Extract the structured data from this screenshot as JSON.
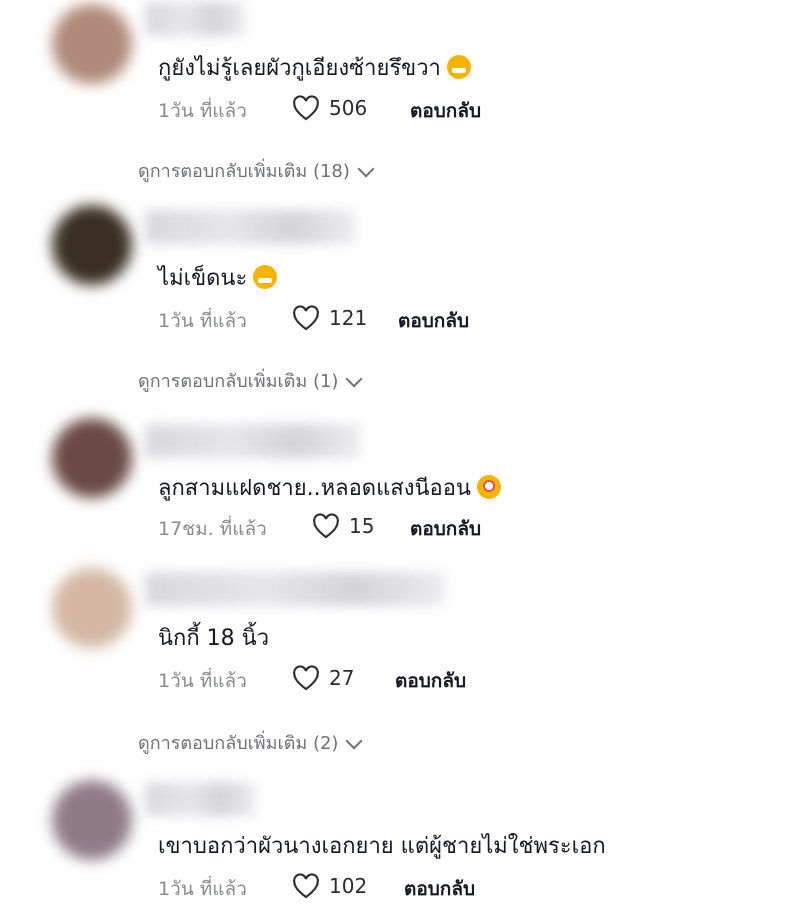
{
  "comments": [
    {
      "text": "กูยังไม่รู้เลยผัวกูเอียงซ้ายรึขวา",
      "emoji": "grinning-emoji",
      "time": "1วัน ที่แล้ว",
      "likes": "506",
      "reply": "ตอบกลับ",
      "more": "ดูการตอบกลับเพิ่มเติม (18)",
      "avatar_color": "#b08a7a"
    },
    {
      "text": "ไม่เข็ดนะ",
      "emoji": "smiling-emoji",
      "time": "1วัน ที่แล้ว",
      "likes": "121",
      "reply": "ตอบกลับ",
      "more": "ดูการตอบกลับเพิ่มเติม (1)",
      "avatar_color": "#3a2f22"
    },
    {
      "text": "ลูกสามแฝดชาย..หลอดแสงนีออน",
      "emoji": "flushed-emoji",
      "time": "17ชม. ที่แล้ว",
      "likes": "15",
      "reply": "ตอบกลับ",
      "more": "",
      "avatar_color": "#6a4a45"
    },
    {
      "text": "นิกกี้ 18 นิ้ว",
      "emoji": "",
      "time": "1วัน ที่แล้ว",
      "likes": "27",
      "reply": "ตอบกลับ",
      "more": "ดูการตอบกลับเพิ่มเติม (2)",
      "avatar_color": "#d4b8a4"
    },
    {
      "text": "เขาบอกว่าผัวนางเอกยาย แต่ผู้ชายไม่ใช่พระเอก",
      "emoji": "",
      "time": "1วัน ที่แล้ว",
      "likes": "102",
      "reply": "ตอบกลับ",
      "more": "",
      "avatar_color": "#8f7a86"
    }
  ]
}
